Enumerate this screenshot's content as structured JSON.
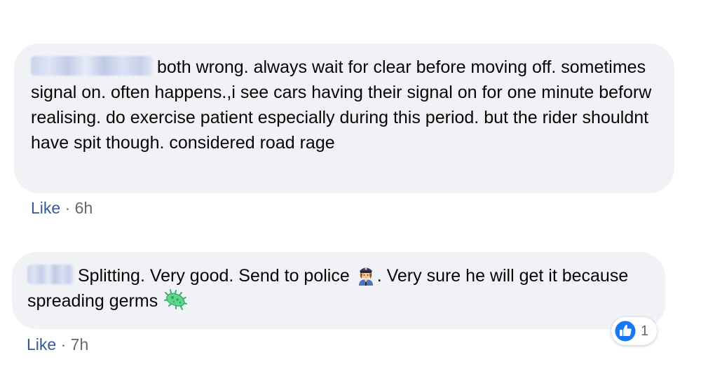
{
  "comments": [
    {
      "author_visible": false,
      "text": "both wrong. always wait for clear before moving off. sometimes signal on. often happens.,i see cars having their signal on for one minute beforw realising. do exercise patient especially during this period. but the rider shouldnt have spit though. considered road rage",
      "like_label": "Like",
      "separator": " · ",
      "time": "6h"
    },
    {
      "author_visible": false,
      "text_part1": "Splitting. Very good. Send to police",
      "text_part2": ". Very sure he will get it because spreading germs",
      "emoji1": "police-officer-woman-icon",
      "emoji2": "microbe-icon",
      "like_label": "Like",
      "separator": " · ",
      "time": "7h",
      "reaction": {
        "icon": "like-thumb-icon",
        "count": "1",
        "color": "#1877f2"
      }
    }
  ],
  "colors": {
    "bubble": "#f0f2f5",
    "like_link": "#385898",
    "meta_text": "#65676b"
  }
}
